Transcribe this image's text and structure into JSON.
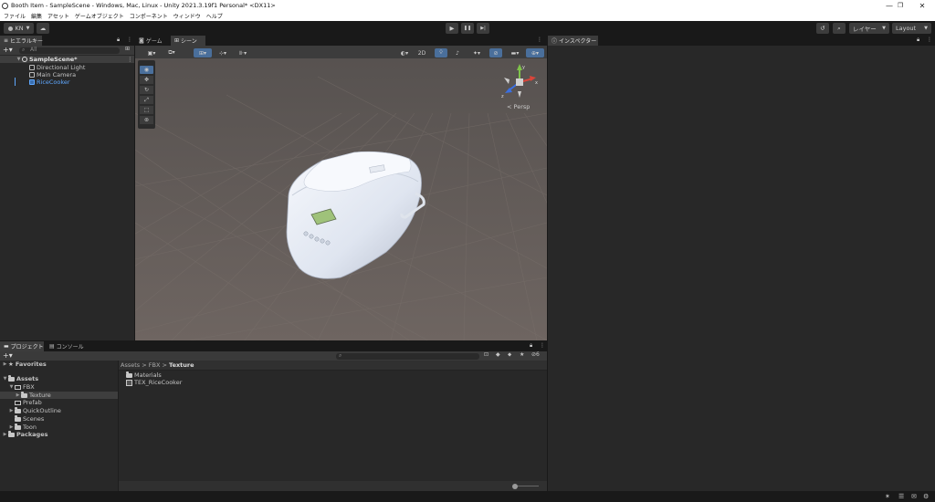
{
  "window": {
    "title": "Booth Item - SampleScene - Windows, Mac, Linux - Unity 2021.3.19f1 Personal* <DX11>",
    "controls": [
      "—",
      "❐",
      "✕"
    ]
  },
  "menu": [
    "ファイル",
    "編集",
    "アセット",
    "ゲームオブジェクト",
    "コンポーネント",
    "ウィンドウ",
    "ヘルプ"
  ],
  "toolbar": {
    "account_label": "KN",
    "play_icons": [
      "▶",
      "❚❚",
      "▶|"
    ],
    "layers_label": "レイヤー",
    "layout_label": "Layout"
  },
  "hierarchy": {
    "tab": "ヒエラルキー",
    "search_placeholder": "All",
    "scene_name": "SampleScene*",
    "items": [
      "Directional Light",
      "Main Camera",
      "RiceCooker"
    ]
  },
  "scene_view": {
    "tabs": [
      "ゲーム",
      "シーン"
    ],
    "toggle_2d": "2D",
    "persp_label": "< Persp",
    "gizmo_labels": {
      "y": "y",
      "x": "x",
      "z": "z"
    }
  },
  "inspector": {
    "tab": "インスペクター"
  },
  "project": {
    "tabs": [
      "プロジェクト",
      "コンソール"
    ],
    "tree": {
      "favorites": "Favorites",
      "assets": "Assets",
      "items": [
        "FBX",
        "Texture",
        "Prefab",
        "QuickOutline",
        "Scenes",
        "Toon"
      ],
      "packages": "Packages"
    },
    "breadcrumb": [
      "Assets",
      "FBX",
      "Texture"
    ],
    "files": [
      "Materials",
      "TEX_RiceCooker"
    ],
    "badge_count": "6"
  },
  "colors": {
    "accent": "#2c5d87",
    "scene_bg": "#6b6460",
    "panel_bg": "#282828",
    "selected_text": "#5fa8ff"
  }
}
